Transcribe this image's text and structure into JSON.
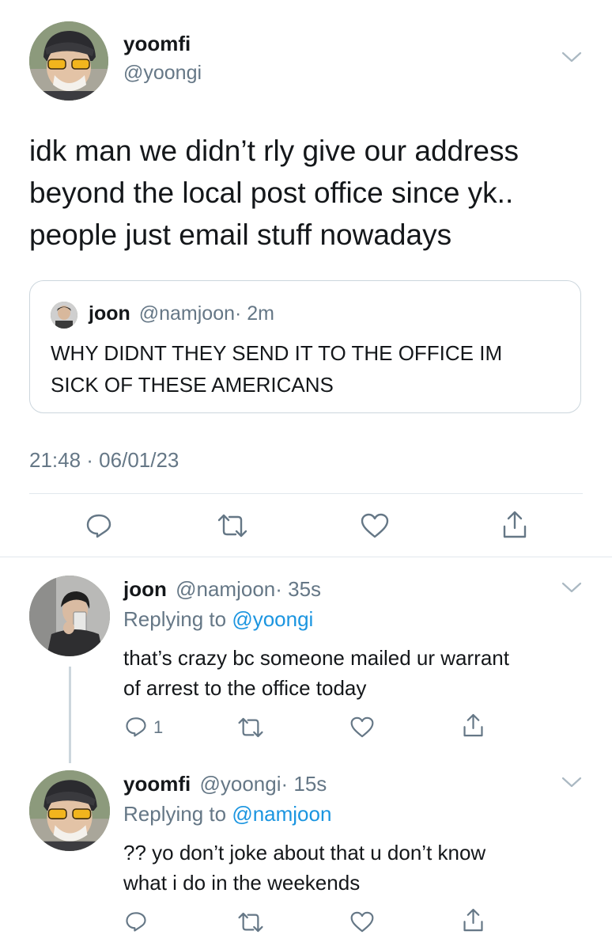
{
  "main_tweet": {
    "display_name": "yoomfi",
    "handle": "@yoongi",
    "text_lines": [
      "idk man we didn’t rly give our address",
      "beyond the local post office since yk..",
      "people just email stuff nowadays"
    ],
    "timestamp": "21:48 · 06/01/23",
    "quoted": {
      "display_name": "joon",
      "handle": "@namjoon",
      "time": "· 2m",
      "text_lines": [
        "WHY DIDNT THEY SEND IT TO THE OFFICE IM",
        "SICK OF THESE AMERICANS"
      ]
    },
    "actions": {
      "reply": "reply-icon",
      "retweet": "retweet-icon",
      "like": "like-icon",
      "share": "share-icon"
    }
  },
  "replies": [
    {
      "display_name": "joon",
      "handle": "@namjoon",
      "time": "· 35s",
      "replying_prefix": "Replying to",
      "replying_to": "@yoongi",
      "text_lines": [
        "that’s crazy bc someone mailed ur warrant",
        "of arrest to the office today"
      ],
      "reply_count": "1"
    },
    {
      "display_name": "yoomfi",
      "handle": "@yoongi",
      "time": "· 15s",
      "replying_prefix": "Replying to",
      "replying_to": "@namjoon",
      "text_lines": [
        "?? yo don’t joke about that u don’t know",
        "what i do in the weekends"
      ],
      "reply_count": ""
    }
  ],
  "colors": {
    "text": "#14171a",
    "muted": "#657786",
    "link": "#1b95e0",
    "divider": "#e1e8ed",
    "icon": "#657786"
  }
}
